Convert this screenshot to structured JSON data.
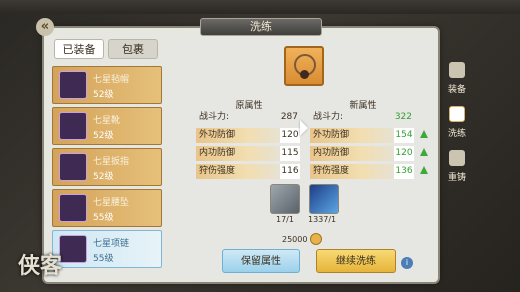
{
  "window": {
    "title": "洗练"
  },
  "tabs": {
    "equipped": "已装备",
    "bag": "包裹"
  },
  "items": [
    {
      "name": "七星毡帽",
      "level": "52级"
    },
    {
      "name": "七星靴",
      "level": "52级"
    },
    {
      "name": "七星扳指",
      "level": "52级"
    },
    {
      "name": "七星腰坠",
      "level": "55级"
    },
    {
      "name": "七星项链",
      "level": "55级"
    }
  ],
  "stats": {
    "original_title": "原属性",
    "new_title": "新属性",
    "power_label": "战斗力:",
    "orig_power": "287",
    "new_power": "322",
    "rows": [
      {
        "label": "外功防御",
        "orig": "120",
        "new": "154"
      },
      {
        "label": "内功防御",
        "orig": "115",
        "new": "120"
      },
      {
        "label": "狩伤强度",
        "orig": "116",
        "new": "136"
      }
    ]
  },
  "materials": [
    {
      "name": "stone",
      "count": "17/1"
    },
    {
      "name": "crystal",
      "count": "1337/1"
    }
  ],
  "cost": "25000",
  "buttons": {
    "keep": "保留属性",
    "continue": "继续洗练"
  },
  "side": {
    "equip": "装备",
    "refine": "洗练",
    "reforge": "重铸"
  },
  "logo": "侠客"
}
